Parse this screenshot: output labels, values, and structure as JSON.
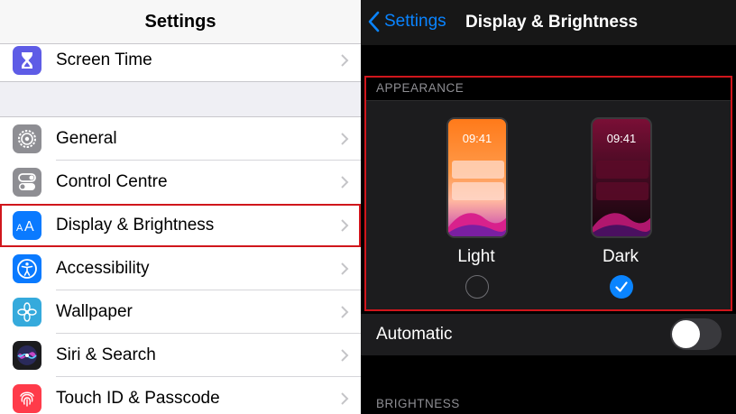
{
  "left_panel": {
    "title": "Settings",
    "top_item": {
      "label": "Screen Time",
      "icon": "hourglass-icon",
      "icon_color": "#5e5ce6"
    },
    "items": [
      {
        "label": "General",
        "icon": "gear-icon",
        "icon_color": "#8e8e93"
      },
      {
        "label": "Control Centre",
        "icon": "toggles-icon",
        "icon_color": "#8e8e93"
      },
      {
        "label": "Display & Brightness",
        "icon": "text-size-icon",
        "icon_color": "#0a7aff",
        "highlighted": true
      },
      {
        "label": "Accessibility",
        "icon": "accessibility-icon",
        "icon_color": "#0a7aff"
      },
      {
        "label": "Wallpaper",
        "icon": "flower-icon",
        "icon_color": "#35aadc"
      },
      {
        "label": "Siri & Search",
        "icon": "siri-icon",
        "icon_color": "#1c1c1e"
      },
      {
        "label": "Touch ID & Passcode",
        "icon": "fingerprint-icon",
        "icon_color": "#ff3b4a"
      }
    ]
  },
  "right_panel": {
    "back_label": "Settings",
    "title": "Display & Brightness",
    "appearance": {
      "header": "APPEARANCE",
      "options": [
        {
          "label": "Light",
          "time": "09:41",
          "selected": false
        },
        {
          "label": "Dark",
          "time": "09:41",
          "selected": true
        }
      ]
    },
    "automatic": {
      "label": "Automatic",
      "enabled": false
    },
    "brightness_header": "BRIGHTNESS"
  },
  "colors": {
    "accent": "#0a84ff",
    "highlight_border": "#d0161c"
  }
}
